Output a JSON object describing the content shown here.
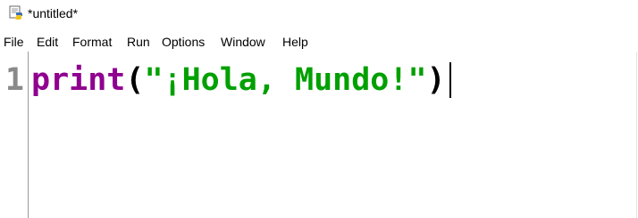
{
  "window": {
    "title": "*untitled*",
    "icon": "python-idle-icon"
  },
  "menu": {
    "items": [
      {
        "label": "File"
      },
      {
        "label": "Edit"
      },
      {
        "label": "Format"
      },
      {
        "label": "Run"
      },
      {
        "label": "Options"
      },
      {
        "label": "Window"
      },
      {
        "label": "Help"
      }
    ]
  },
  "editor": {
    "line_numbers": [
      "1"
    ],
    "lines": [
      {
        "tokens": {
          "builtin": "print",
          "open_paren": "(",
          "string": "\"¡Hola, Mundo!\"",
          "close_paren": ")"
        }
      }
    ]
  },
  "colors": {
    "builtin": "#900090",
    "string": "#00a000",
    "line_number": "#8a8a8a",
    "background": "#ffffff"
  }
}
